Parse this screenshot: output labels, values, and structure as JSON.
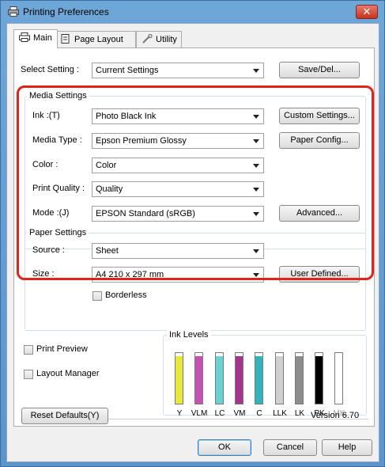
{
  "window": {
    "title": "Printing Preferences",
    "close_label": "✕"
  },
  "tabs": [
    {
      "label": "Main"
    },
    {
      "label": "Page Layout"
    },
    {
      "label": "Utility"
    }
  ],
  "select_setting": {
    "label": "Select Setting :",
    "value": "Current Settings",
    "button": "Save/Del..."
  },
  "media_settings": {
    "title": "Media Settings",
    "ink": {
      "label": "Ink :(T)",
      "value": "Photo Black Ink",
      "button": "Custom Settings..."
    },
    "media_type": {
      "label": "Media Type :",
      "value": "Epson Premium Glossy",
      "button": "Paper Config..."
    },
    "color": {
      "label": "Color :",
      "value": "Color"
    },
    "print_quality": {
      "label": "Print Quality :",
      "value": "Quality"
    },
    "mode": {
      "label": "Mode :(J)",
      "value": "EPSON Standard (sRGB)",
      "button": "Advanced..."
    }
  },
  "paper_settings": {
    "title": "Paper Settings",
    "source": {
      "label": "Source :",
      "value": "Sheet"
    },
    "size": {
      "label": "Size :",
      "value": "A4 210 x 297 mm",
      "button": "User Defined..."
    },
    "borderless": {
      "label": "Borderless",
      "checked": false
    }
  },
  "print_preview": {
    "label": "Print Preview",
    "checked": false
  },
  "layout_manager": {
    "label": "Layout Manager",
    "checked": false
  },
  "ink_levels": {
    "title": "Ink Levels",
    "inks": [
      {
        "code": "Y",
        "color": "#e8e83a",
        "level": 0.93
      },
      {
        "code": "VLM",
        "color": "#c74fb5",
        "level": 0.93
      },
      {
        "code": "LC",
        "color": "#69d3d3",
        "level": 0.93
      },
      {
        "code": "VM",
        "color": "#a4348f",
        "level": 0.93
      },
      {
        "code": "C",
        "color": "#31b5bd",
        "level": 0.93
      },
      {
        "code": "LLK",
        "color": "#d0d0d0",
        "level": 0.93
      },
      {
        "code": "LK",
        "color": "#8c8c8c",
        "level": 0.93
      },
      {
        "code": "PK",
        "color": "#000000",
        "level": 0.93
      },
      {
        "code": "MK",
        "color": "#ffffff",
        "level": 0.0
      }
    ]
  },
  "reset_defaults": "Reset Defaults(Y)",
  "version": "Version 6.70",
  "footer": {
    "ok": "OK",
    "cancel": "Cancel",
    "help": "Help"
  },
  "colors": {
    "highlight": "#e0241b",
    "title_bar": "#6fa6d8"
  }
}
